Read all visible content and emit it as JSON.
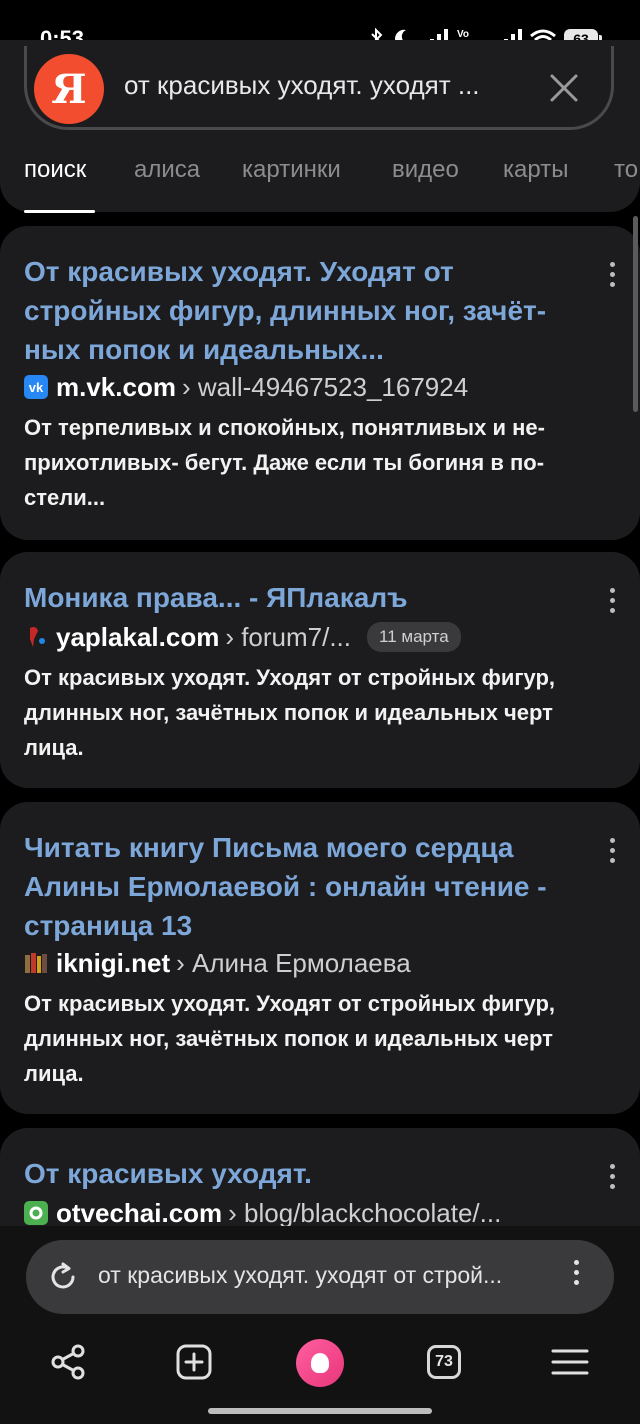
{
  "status_bar": {
    "time": "0:53",
    "battery": "63",
    "network_label": "Vo WiFi"
  },
  "search": {
    "logo_letter": "Я",
    "query": "от красивых уходят. уходят ..."
  },
  "tabs": [
    "поиск",
    "алиса",
    "картинки",
    "видео",
    "карты",
    "то"
  ],
  "results": [
    {
      "title_lines": [
        "От красивых уходят. Уходят от",
        "стройных фигур, длинных ног, зачёт-",
        "ных попок и идеальных..."
      ],
      "favicon": "vk-icon",
      "favicon_text": "vk",
      "domain": "m.vk.com",
      "path": "› wall-49467523_167924",
      "snippet_lines": [
        "От терпеливых и спокойных, понятливых и не-",
        "прихотливых- бегут. Даже если ты богиня в по-",
        "стели..."
      ]
    },
    {
      "title_lines": [
        "Моника права... - ЯПлакалъ"
      ],
      "favicon": "yaplakal-icon",
      "domain": "yaplakal.com",
      "path": "› forum7/...",
      "date": "11 марта",
      "snippet_lines": [
        "От красивых уходят. Уходят от стройных фигур,",
        "длинных ног, зачётных попок и идеальных черт",
        "лица."
      ]
    },
    {
      "title_lines": [
        "Читать книгу Письма моего сердца",
        "Алины Ермолаевой : онлайн чтение -",
        "страница 13"
      ],
      "favicon": "books-icon",
      "domain": "iknigi.net",
      "path": "› Алина Ермолаева",
      "snippet_lines": [
        "От красивых уходят. Уходят от стройных фигур,",
        "длинных ног, зачётных попок и идеальных черт",
        "лица."
      ]
    },
    {
      "title_lines": [
        "От красивых уходят."
      ],
      "favicon": "otvechai-icon",
      "domain": "otvechai.com",
      "path": "› blog/blackchocolate/..."
    }
  ],
  "address_bar": {
    "text": "от красивых уходят. уходят от строй..."
  },
  "bottom_nav": {
    "tabs_count": "73"
  },
  "colors": {
    "background": "#000000",
    "card": "#1c1c1e",
    "link": "#7da7d9",
    "yandex_logo": "#f24d2f",
    "alice": "#ee4a8a"
  }
}
